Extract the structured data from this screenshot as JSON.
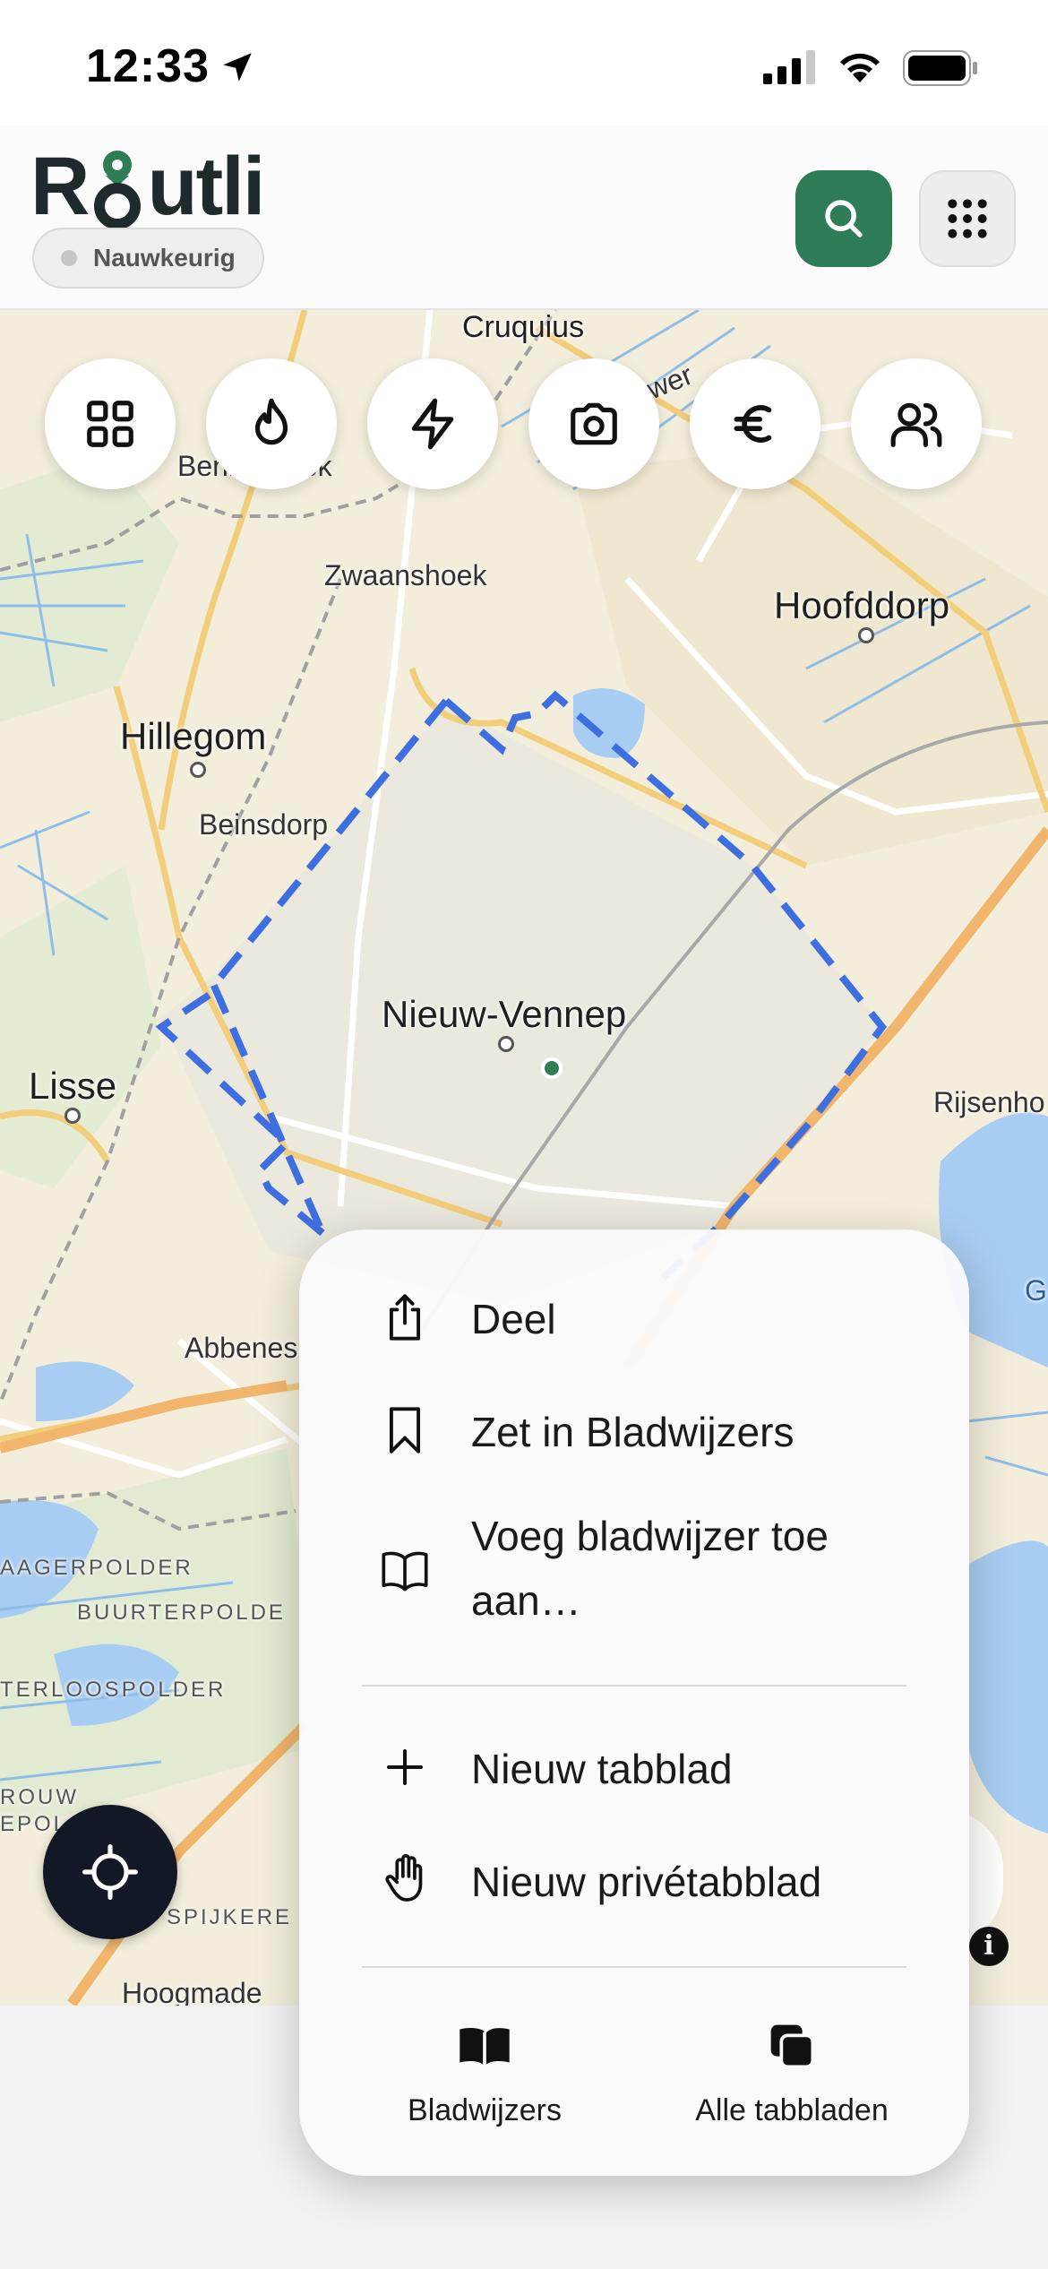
{
  "status_bar": {
    "time": "12:33"
  },
  "header": {
    "logo_prefix": "R",
    "logo_suffix": "utli",
    "accuracy_label": "Nauwkeurig"
  },
  "categories": [
    {
      "icon": "grid-icon"
    },
    {
      "icon": "flame-icon"
    },
    {
      "icon": "lightning-icon"
    },
    {
      "icon": "camera-icon"
    },
    {
      "icon": "euro-icon"
    },
    {
      "icon": "users-icon"
    }
  ],
  "map": {
    "labels": {
      "cruquius": "Cruquius",
      "bennebroek": "Bennebroek",
      "zwaanshoek": "Zwaanshoek",
      "hoofddorp": "Hoofddorp",
      "hillegom": "Hillegom",
      "beinsdorp": "Beinsdorp",
      "nieuw_vennep": "Nieuw-Vennep",
      "lisse": "Lisse",
      "rijsenhout": "Rijsenho",
      "abbenes": "Abbenes",
      "g": "G",
      "haagerpolder": "AAGERPOLDER",
      "buurterpolder": "BUURTERPOLDE",
      "ooster": "TERLOOSPOLDER",
      "rouw": "ROUW",
      "epol": "EPOL",
      "spijker": "SPIJKERE",
      "hoogmade": "Hoogmade",
      "road_wer": "wer"
    }
  },
  "context_menu": {
    "items": [
      {
        "label": "Deel",
        "icon": "share-icon"
      },
      {
        "label": "Zet in Bladwijzers",
        "icon": "bookmark-icon"
      },
      {
        "label": "Voeg bladwijzer toe aan…",
        "icon": "book-open-icon"
      },
      {
        "label": "Nieuw tabblad",
        "icon": "plus-icon"
      },
      {
        "label": "Nieuw privétabblad",
        "icon": "hand-icon"
      }
    ],
    "bottom": [
      {
        "label": "Bladwijzers",
        "icon": "bookmarks-book-icon"
      },
      {
        "label": "Alle tabbladen",
        "icon": "tabs-icon"
      }
    ]
  },
  "colors": {
    "accent_green": "#2e7d57",
    "locate_dark": "#121826",
    "boundary_blue": "#3d6fe0",
    "water": "#a8cdf2"
  }
}
